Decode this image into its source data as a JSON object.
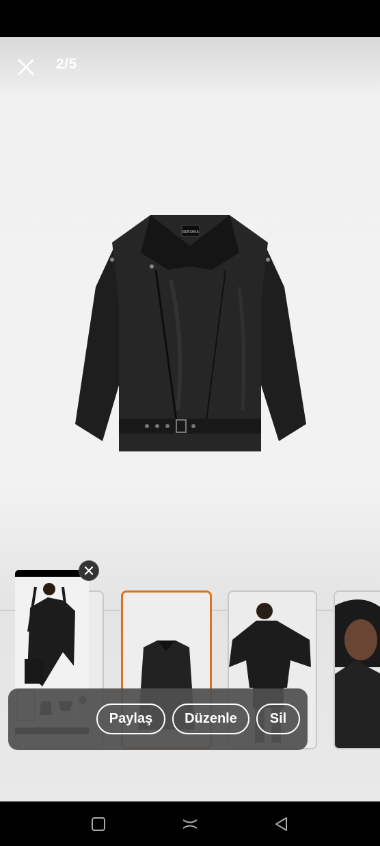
{
  "viewer": {
    "counter": "2/5",
    "jacket_label": "BERSHKA"
  },
  "actions": {
    "share_label": "Paylaş",
    "edit_label": "Düzenle",
    "delete_label": "Sil"
  },
  "icons": {
    "close": "close-icon",
    "pip_close": "close-icon",
    "nav_recents": "recents-icon",
    "nav_home": "home-icon",
    "nav_back": "back-icon"
  },
  "colors": {
    "selected_border": "#d9731f",
    "action_bar": "#505050"
  }
}
